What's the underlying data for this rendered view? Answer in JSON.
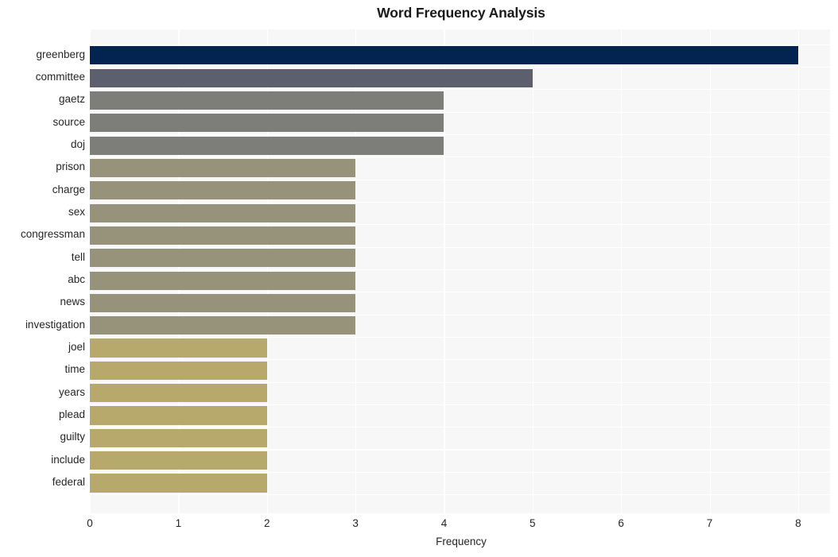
{
  "chart_data": {
    "type": "bar",
    "orientation": "horizontal",
    "title": "Word Frequency Analysis",
    "xlabel": "Frequency",
    "ylabel": "",
    "xlim": [
      0,
      8.36
    ],
    "xticks": [
      0,
      1,
      2,
      3,
      4,
      5,
      6,
      7,
      8
    ],
    "xtick_labels": [
      "0",
      "1",
      "2",
      "3",
      "4",
      "5",
      "6",
      "7",
      "8"
    ],
    "grid": true,
    "legend": "none",
    "categories": [
      "greenberg",
      "committee",
      "gaetz",
      "source",
      "doj",
      "prison",
      "charge",
      "sex",
      "congressman",
      "tell",
      "abc",
      "news",
      "investigation",
      "joel",
      "time",
      "years",
      "plead",
      "guilty",
      "include",
      "federal"
    ],
    "values": [
      8,
      5,
      4,
      4,
      4,
      3,
      3,
      3,
      3,
      3,
      3,
      3,
      3,
      2,
      2,
      2,
      2,
      2,
      2,
      2
    ],
    "bar_colors": [
      "#032350",
      "#5c606e",
      "#7d7d7a",
      "#7d7d7a",
      "#7d7d7a",
      "#97927a",
      "#97927a",
      "#97927a",
      "#97927a",
      "#97927a",
      "#97927a",
      "#97927a",
      "#97927a",
      "#b7a96b",
      "#b7a96b",
      "#b7a96b",
      "#b7a96b",
      "#b7a96b",
      "#b7a96b",
      "#b7a96b"
    ],
    "plot_background": "#f7f7f8",
    "gridline_color": "#ffffff",
    "text_color": "#262626"
  }
}
